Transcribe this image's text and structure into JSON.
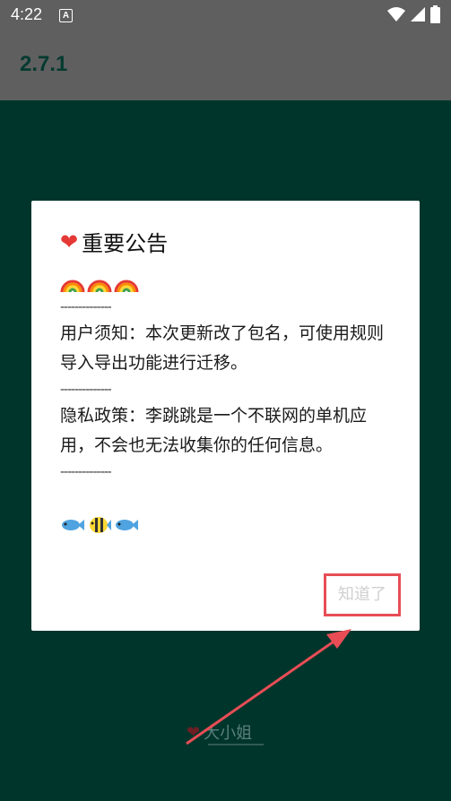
{
  "status_bar": {
    "time": "4:22",
    "notification_icon": "A"
  },
  "app_bar": {
    "title": "2.7.1"
  },
  "dialog": {
    "title": "重要公告",
    "title_icon": "red-heart-icon",
    "rainbow_icon": "rainbow-icon",
    "divider_1": "--------------",
    "para_1": "用户须知：本次更新改了包名，可使用规则导入导出功能进行迁移。",
    "divider_2": "--------------",
    "para_2": "隐私政策：李跳跳是一个不联网的单机应用，不会也无法收集你的任何信息。",
    "divider_3": "--------------",
    "fish_icons": [
      "fish-icon",
      "tropical-fish-icon",
      "fish-icon"
    ],
    "ok_button": "知道了"
  },
  "bottom": {
    "label": "大小姐"
  },
  "colors": {
    "status_bar": "#5f5f5f",
    "background": "#00352c",
    "highlight": "#e84d55"
  }
}
